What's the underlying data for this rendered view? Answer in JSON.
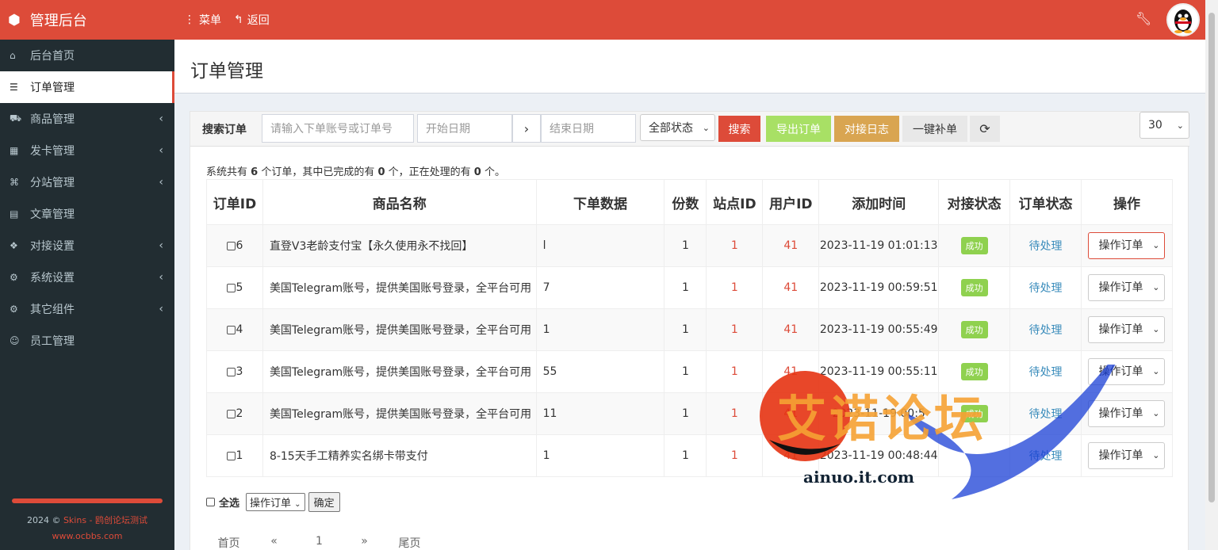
{
  "topbar": {
    "app_title": "管理后台",
    "menu_label": "菜单",
    "back_label": "返回"
  },
  "sidebar": {
    "items": [
      {
        "label": "后台首页",
        "icon": "home-icon",
        "glyph": "⌂",
        "chev": ""
      },
      {
        "label": "订单管理",
        "icon": "list-icon",
        "glyph": "☰",
        "chev": ""
      },
      {
        "label": "商品管理",
        "icon": "cart-icon",
        "glyph": "⛟",
        "chev": "‹"
      },
      {
        "label": "发卡管理",
        "icon": "grid-icon",
        "glyph": "▦",
        "chev": "‹"
      },
      {
        "label": "分站管理",
        "icon": "sitemap-icon",
        "glyph": "⌘",
        "chev": "‹"
      },
      {
        "label": "文章管理",
        "icon": "book-icon",
        "glyph": "▤",
        "chev": ""
      },
      {
        "label": "对接设置",
        "icon": "cubes-icon",
        "glyph": "❖",
        "chev": "‹"
      },
      {
        "label": "系统设置",
        "icon": "gear-icon",
        "glyph": "⚙",
        "chev": "‹"
      },
      {
        "label": "其它组件",
        "icon": "cogs-icon",
        "glyph": "⚙",
        "chev": "‹"
      },
      {
        "label": "员工管理",
        "icon": "user-circle-icon",
        "glyph": "☺",
        "chev": ""
      }
    ],
    "footer": {
      "year_prefix": "2024 © ",
      "brand": "Skins - 鸥创论坛测试",
      "site": "www.ocbbs.com"
    }
  },
  "page": {
    "title": "订单管理"
  },
  "search": {
    "label": "搜索订单",
    "keyword_placeholder": "请输入下单账号或订单号",
    "start_placeholder": "开始日期",
    "end_placeholder": "结束日期",
    "status_select": "全部状态",
    "search_btn": "搜索",
    "export_btn": "导出订单",
    "log_btn": "对接日志",
    "refill_btn": "一键补单",
    "page_size": "30"
  },
  "colors": {
    "brand": "#dd4b39",
    "success": "#8fd14f",
    "warning": "#d9a551",
    "link": "#3c8dbc"
  },
  "summary": {
    "prefix": "系统共有 ",
    "total": "6",
    "mid1": " 个订单，其中已完成的有 ",
    "completed": "0",
    "mid2": " 个，正在处理的有 ",
    "processing": "0",
    "suffix": " 个。"
  },
  "table": {
    "headers": [
      "订单ID",
      "商品名称",
      "下单数据",
      "份数",
      "站点ID",
      "用户ID",
      "添加时间",
      "对接状态",
      "订单状态",
      "操作"
    ],
    "rows": [
      {
        "id": "6",
        "name": "直登V3老龄支付宝【永久使用永不找回】",
        "data": "l",
        "qty": "1",
        "site": "1",
        "user": "41",
        "time": "2023-11-19 01:01:13",
        "dock": "成功",
        "status": "待处理",
        "op": "操作订单"
      },
      {
        "id": "5",
        "name": "美国Telegram账号，提供美国账号登录，全平台可用",
        "data": "7",
        "qty": "1",
        "site": "1",
        "user": "41",
        "time": "2023-11-19 00:59:51",
        "dock": "成功",
        "status": "待处理",
        "op": "操作订单"
      },
      {
        "id": "4",
        "name": "美国Telegram账号，提供美国账号登录，全平台可用",
        "data": "1",
        "qty": "1",
        "site": "1",
        "user": "41",
        "time": "2023-11-19 00:55:49",
        "dock": "成功",
        "status": "待处理",
        "op": "操作订单"
      },
      {
        "id": "3",
        "name": "美国Telegram账号，提供美国账号登录，全平台可用",
        "data": "55",
        "qty": "1",
        "site": "1",
        "user": "41",
        "time": "2023-11-19 00:55:11",
        "dock": "成功",
        "status": "待处理",
        "op": "操作订单"
      },
      {
        "id": "2",
        "name": "美国Telegram账号，提供美国账号登录，全平台可用",
        "data": "11",
        "qty": "1",
        "site": "1",
        "user": "41",
        "time": "2023-11-19 00:5",
        "dock": "成功",
        "status": "待处理",
        "op": "操作订单"
      },
      {
        "id": "1",
        "name": "8-15天手工精养实名绑卡带支付",
        "data": "1",
        "qty": "1",
        "site": "1",
        "user": "41",
        "time": "2023-11-19 00:48:44",
        "dock": "",
        "status": "待处理",
        "op": "操作订单"
      }
    ]
  },
  "bulk": {
    "select_all": "全选",
    "action": "操作订单",
    "confirm": "确定"
  },
  "pager": {
    "first": "首页",
    "prev": "«",
    "page": "1",
    "next": "»",
    "last": "尾页"
  },
  "watermark": {
    "text": "艾诺论坛",
    "url": "ainuo.it.com"
  }
}
